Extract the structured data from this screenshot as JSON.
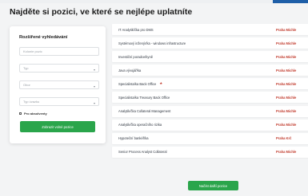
{
  "page": {
    "title": "Najděte si pozici, ve které se nejlépe uplatníte"
  },
  "filters": {
    "title": "Rozšířené vyhledávání",
    "search_placeholder": "Kolonie pozic",
    "selects": [
      {
        "label": "Typ"
      },
      {
        "label": "Obor"
      },
      {
        "label": "Typ úvazku"
      }
    ],
    "checkbox_label": "Pro absolventy",
    "submit_label": "Zobrazit volné pozice"
  },
  "jobs": [
    {
      "title": "IT Analytik/čka pro DMS",
      "location": "Praha Michle"
    },
    {
      "title": "Systémový inženýr/ka - windows infrastructure",
      "location": "Praha Michle"
    },
    {
      "title": "Investiční poradce/kyně",
      "location": "Praha Michle"
    },
    {
      "title": "Java vývojář/ka",
      "location": "Praha Michle"
    },
    {
      "title": "Specialista/ka Back Office",
      "badge": "★",
      "location": "Praha Michle"
    },
    {
      "title": "Specialista/ka Treasury Back Office",
      "location": "Praha Michle"
    },
    {
      "title": "Analytik/čka Collateral Management",
      "location": "Praha Michle"
    },
    {
      "title": "Analytik/čka operačního rizika",
      "location": "Praha Michle"
    },
    {
      "title": "Hypoteční bankéř/ka",
      "location": "Praha Krč"
    },
    {
      "title": "Senior Process Analyst Collateral",
      "location": "Praha Michle"
    }
  ],
  "more_button_label": "Načíst další pozice",
  "colors": {
    "accent_green": "#2aa54b",
    "location_red": "#c0392b",
    "top_accent_blue": "#1f5fa8"
  }
}
